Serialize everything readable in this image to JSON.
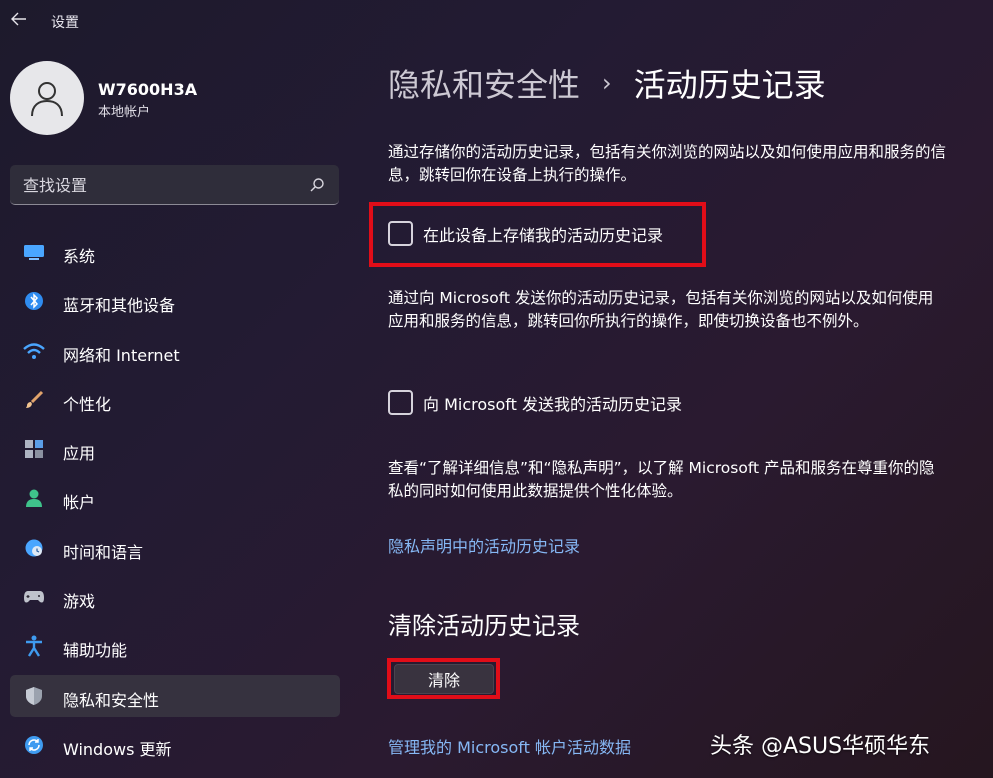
{
  "window": {
    "title": "设置"
  },
  "user": {
    "name": "W7600H3A",
    "account_type": "本地帐户"
  },
  "search": {
    "placeholder": "查找设置"
  },
  "sidebar": {
    "items": [
      {
        "label": "系统",
        "icon": "system-display-icon",
        "color": "#4aa6ff"
      },
      {
        "label": "蓝牙和其他设备",
        "icon": "bluetooth-icon",
        "color": "#2f8cf0"
      },
      {
        "label": "网络和 Internet",
        "icon": "wifi-icon",
        "color": "#4aa6ff"
      },
      {
        "label": "个性化",
        "icon": "brush-icon",
        "color": "#e0a36b"
      },
      {
        "label": "应用",
        "icon": "apps-icon",
        "color": "#aeb4c2"
      },
      {
        "label": "帐户",
        "icon": "person-icon",
        "color": "#3fc38b"
      },
      {
        "label": "时间和语言",
        "icon": "clock-globe-icon",
        "color": "#4aa6ff"
      },
      {
        "label": "游戏",
        "icon": "gamepad-icon",
        "color": "#bfc3cc"
      },
      {
        "label": "辅助功能",
        "icon": "accessibility-icon",
        "color": "#3f9bf0"
      },
      {
        "label": "隐私和安全性",
        "icon": "shield-icon",
        "color": "#9ba2ae",
        "active": true
      },
      {
        "label": "Windows 更新",
        "icon": "update-icon",
        "color": "#3f9bf0"
      }
    ]
  },
  "main": {
    "breadcrumb_parent": "隐私和安全性",
    "breadcrumb_separator": "›",
    "page_title": "活动历史记录",
    "para1": "通过存储你的活动历史记录，包括有关你浏览的网站以及如何使用应用和服务的信息，跳转回你在设备上执行的操作。",
    "checkbox1_label": "在此设备上存储我的活动历史记录",
    "checkbox1_checked": false,
    "para2": "通过向 Microsoft 发送你的活动历史记录，包括有关你浏览的网站以及如何使用应用和服务的信息，跳转回你所执行的操作，即使切换设备也不例外。",
    "checkbox2_label": "向 Microsoft 发送我的活动历史记录",
    "checkbox2_checked": false,
    "para3": "查看“了解详细信息”和“隐私声明”，以了解 Microsoft 产品和服务在尊重你的隐私的同时如何使用此数据提供个性化体验。",
    "link_privacy": "隐私声明中的活动历史记录",
    "clear_section_title": "清除活动历史记录",
    "clear_button": "清除",
    "link_manage": "管理我的 Microsoft 帐户活动数据"
  },
  "watermark": "头条 @ASUS华硕华东",
  "colors": {
    "highlight": "#e10d18",
    "link": "#86b8f5"
  }
}
